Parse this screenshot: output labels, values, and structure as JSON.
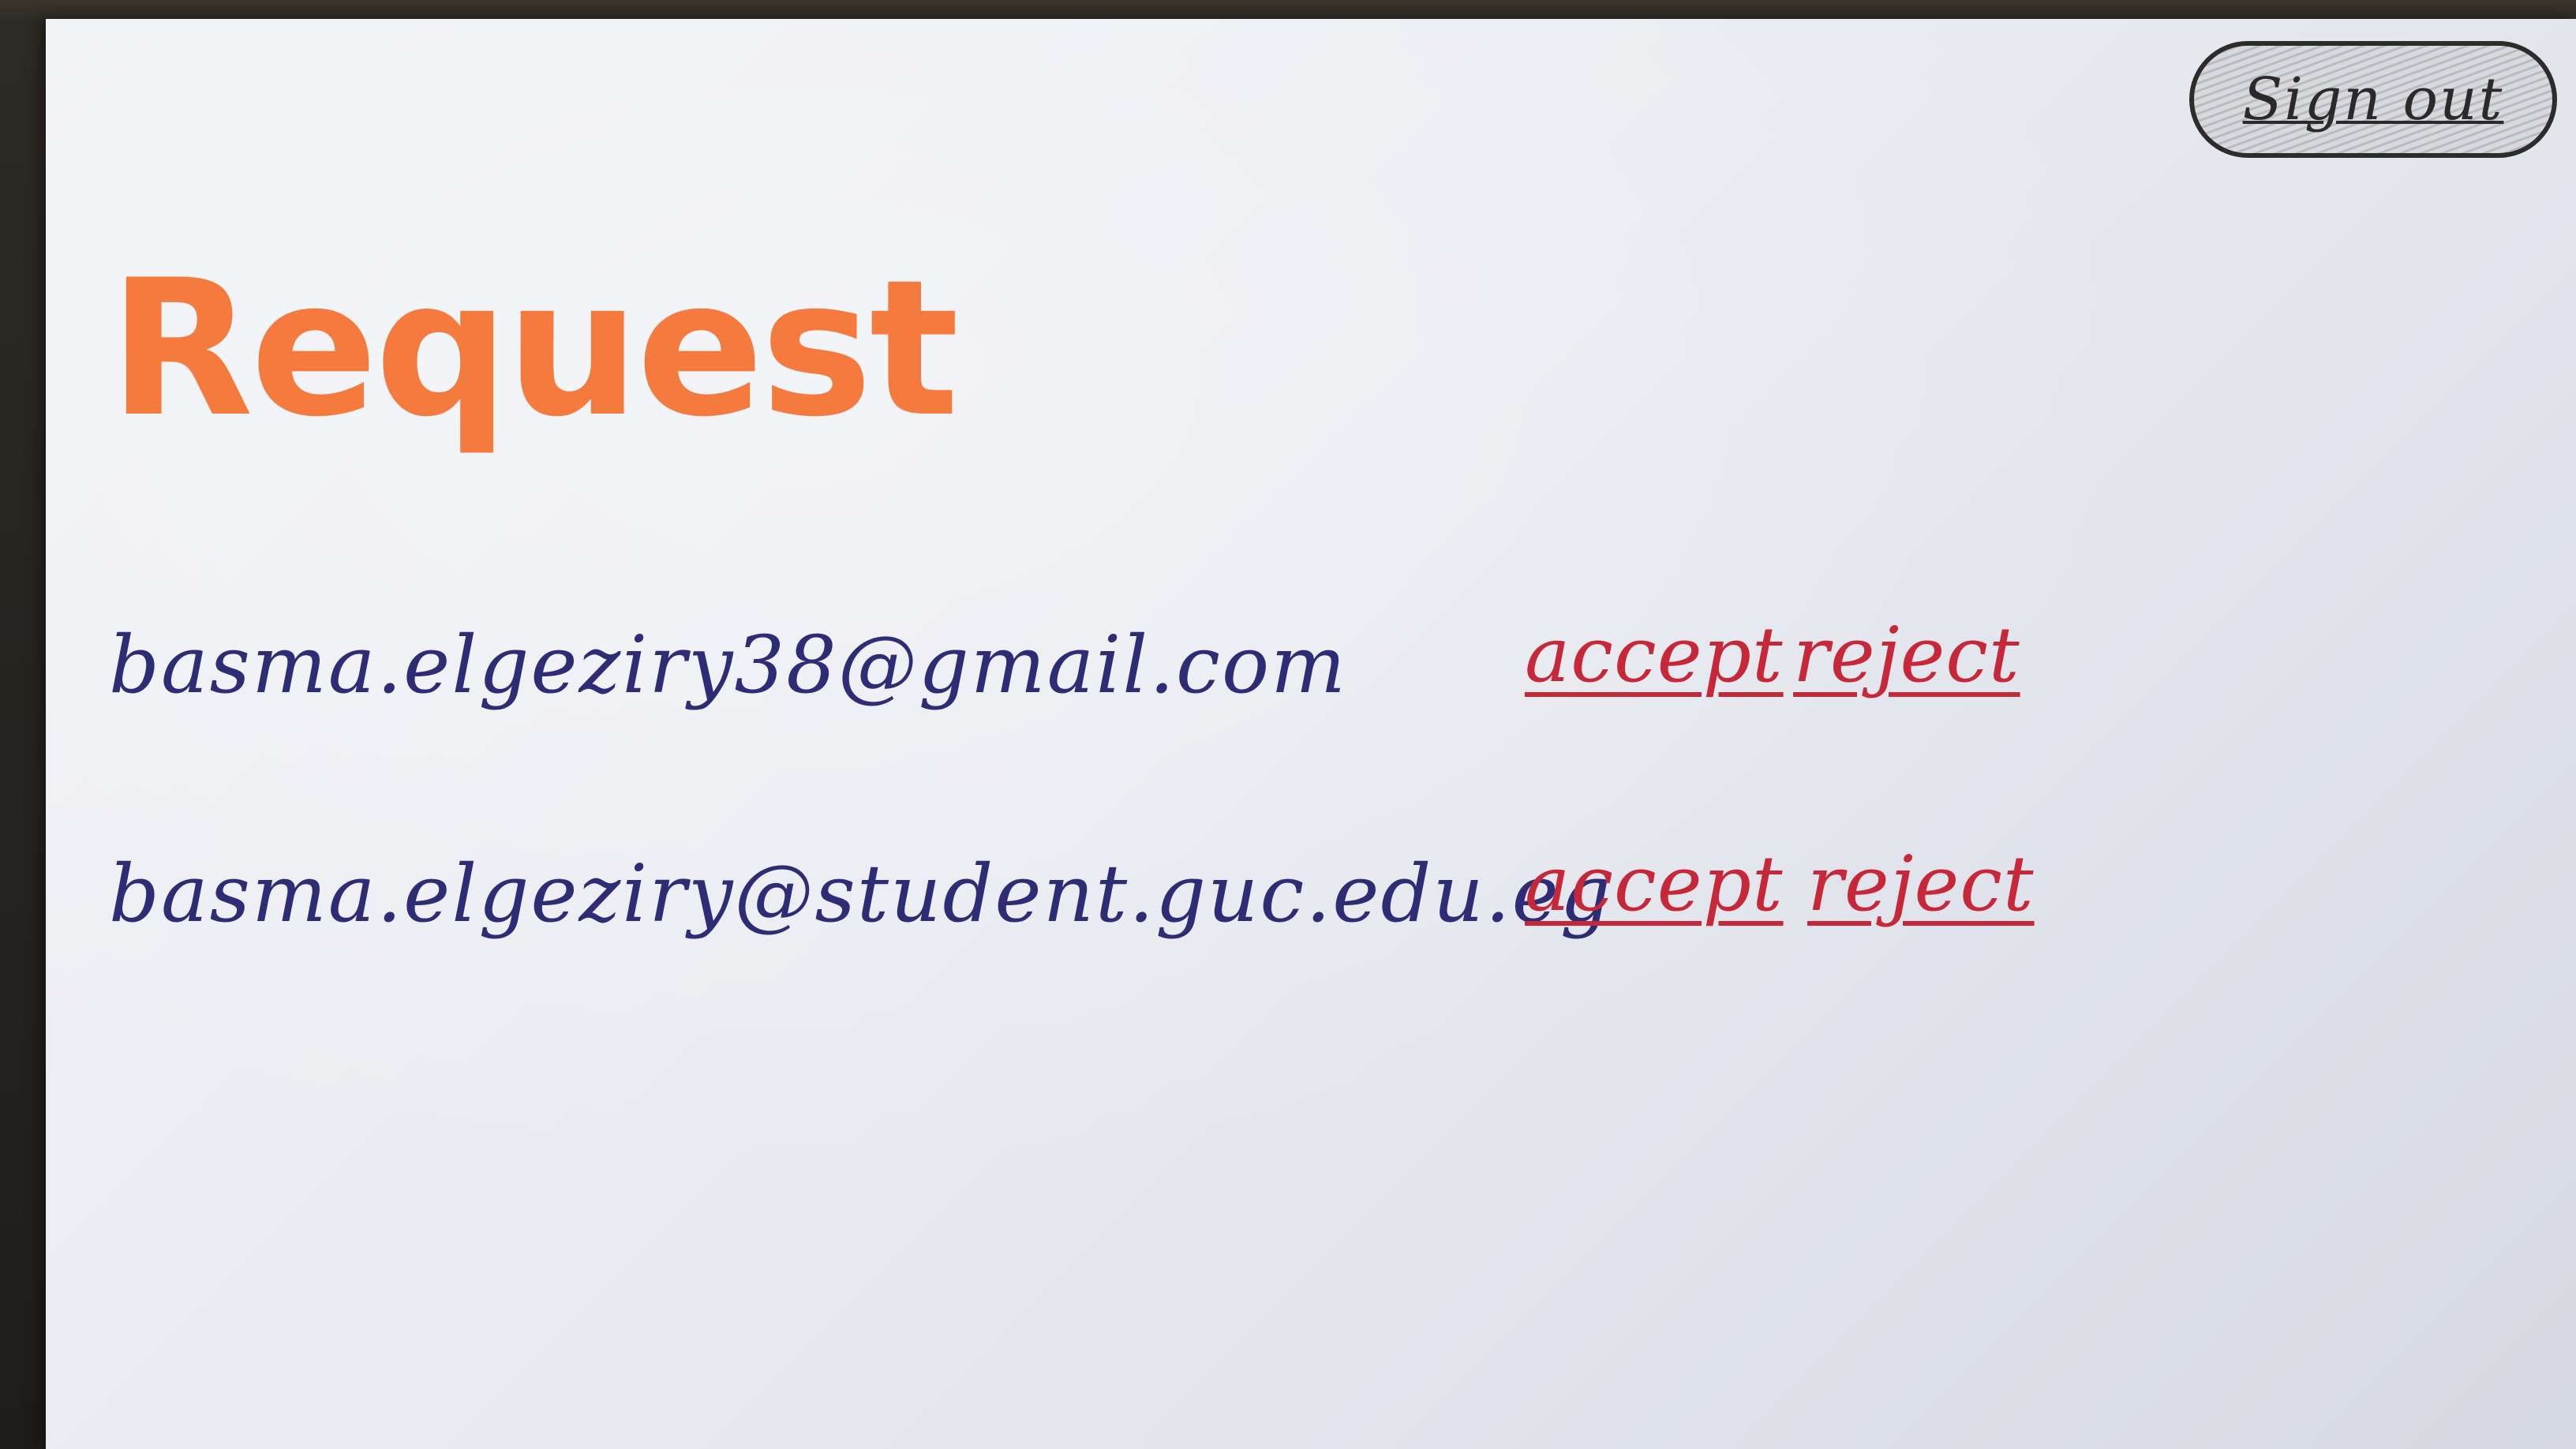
{
  "header": {
    "sign_out_label": "Sign out"
  },
  "page": {
    "title": "Request"
  },
  "requests": [
    {
      "email": "basma.elgeziry38@gmail.com",
      "accept_label": "accept",
      "reject_label": "reject"
    },
    {
      "email": "basma.elgeziry@student.guc.edu.eg",
      "accept_label": "accept",
      "reject_label": "reject"
    }
  ],
  "colors": {
    "title": "#f47a3e",
    "email": "#2e2c74",
    "action": "#c62839",
    "paper": "#e9ebf1",
    "outline": "#2c2c2c"
  }
}
